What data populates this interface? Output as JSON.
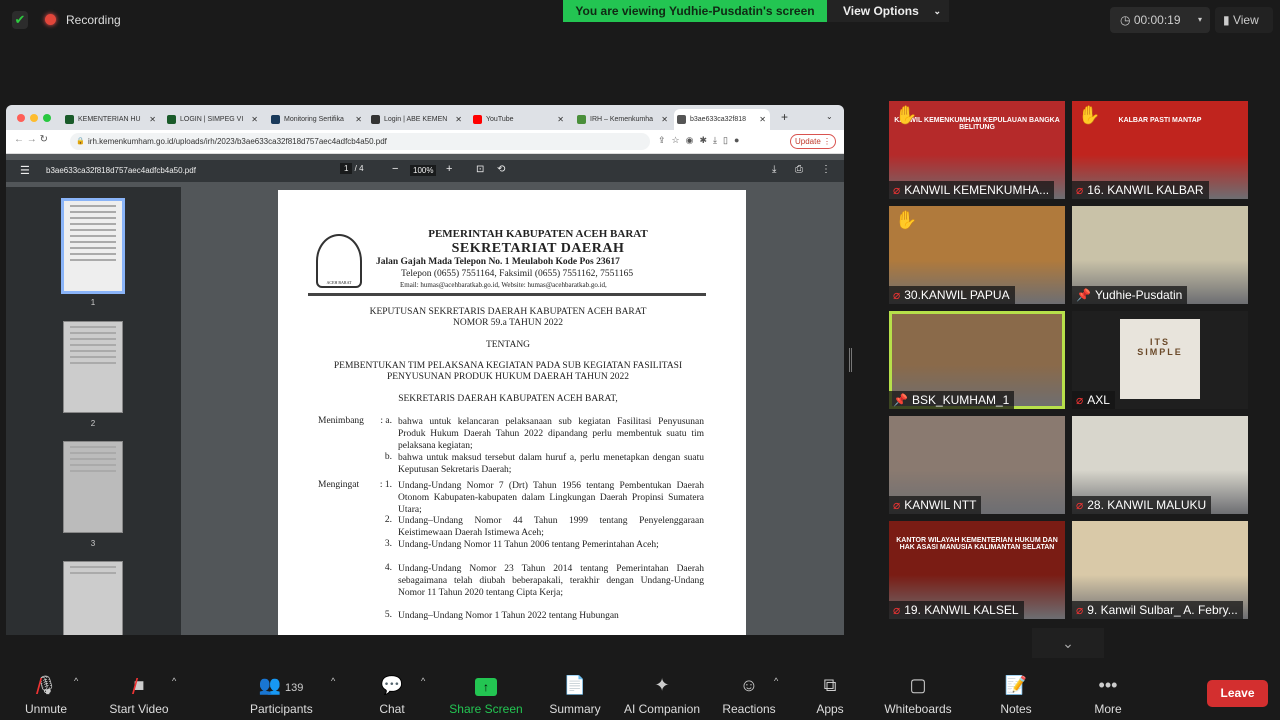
{
  "top": {
    "recording": "Recording",
    "viewing": "You are viewing Yudhie-Pusdatin's screen",
    "view_options": "View Options",
    "timer": "00:00:19",
    "view": "View"
  },
  "browser": {
    "tabs": [
      {
        "label": "KEMENTERIAN HU",
        "color": "#1a5b2a"
      },
      {
        "label": "LOGIN | SIMPEG VI",
        "color": "#1a5b2a"
      },
      {
        "label": "Monitoring Sertifika",
        "color": "#1a3a5b"
      },
      {
        "label": "Login | ABE KEMEN",
        "color": "#333"
      },
      {
        "label": "YouTube",
        "color": "#ff0000"
      },
      {
        "label": "IRH – Kemenkumha",
        "color": "#4a8f3a"
      },
      {
        "label": "b3ae633ca32f818",
        "color": "#555"
      }
    ],
    "url": "irh.kemenkumham.go.id/uploads/irh/2023/b3ae633ca32f818d757aec4adfcb4a50.pdf",
    "update": "Update",
    "pdf": {
      "filename": "b3ae633ca32f818d757aec4adfcb4a50.pdf",
      "page": "1",
      "pages": "4",
      "zoom": "100%",
      "thumbs": [
        "1",
        "2",
        "3"
      ]
    }
  },
  "doc": {
    "h1": "PEMERINTAH KABUPATEN ACEH BARAT",
    "h2": "SEKRETARIAT DAERAH",
    "h3": "Jalan Gajah Mada Telepon No. 1 Meulaboh Kode Pos 23617",
    "h4": "Telepon (0655) 7551164, Faksimil  (0655) 7551162, 7551165",
    "h5": "Email: humas@acehbaratkab.go.id, Website: humas@acehbaratkab.go.id,",
    "logo_text": "ACEH BARAT",
    "t1": "KEPUTUSAN SEKRETARIS DAERAH KABUPATEN ACEH BARAT",
    "t2": "NOMOR  59.a TAHUN 2022",
    "t3": "TENTANG",
    "t4": "PEMBENTUKAN TIM PELAKSANA KEGIATAN PADA SUB KEGIATAN FASILITASI",
    "t5": "PENYUSUNAN PRODUK HUKUM DAERAH TAHUN 2022",
    "t6": "SEKRETARIS DAERAH KABUPATEN ACEH BARAT,",
    "menimbang": "Menimbang",
    "mengingat": "Mengingat",
    "m_a": "bahwa untuk kelancaran pelaksanaan sub kegiatan Fasilitasi Penyusunan Produk Hukum Daerah Tahun 2022 dipandang perlu membentuk suatu tim pelaksana kegiatan;",
    "m_b": "bahwa untuk maksud tersebut dalam huruf a, perlu menetapkan dengan suatu Keputusan Sekretaris Daerah;",
    "g1": "Undang-Undang Nomor 7 (Drt) Tahun 1956 tentang Pembentukan Daerah Otonom Kabupaten-kabupaten dalam Lingkungan Daerah Propinsi Sumatera Utara;",
    "g2": "Undang–Undang Nomor 44 Tahun 1999 tentang Penyelenggaraan Keistimewaan Daerah Istimewa Aceh;",
    "g3": "Undang-Undang Nomor 11 Tahun 2006 tentang Pemerintahan Aceh;",
    "g4": "Undang-Undang Nomor 23 Tahun 2014 tentang Pemerintahan Daerah sebagaimana telah diubah beberapakali, terakhir dengan Undang-Undang Nomor 11 Tahun 2020 tentang Cipta Kerja;",
    "g5": "Undang–Undang Nomor 1 Tahun 2022 tentang Hubungan"
  },
  "tiles": [
    {
      "name": "KANWIL KEMENKUMHA...",
      "banner": "KANWIL KEMENKUMHAM KEPULAUAN BANGKA BELITUNG",
      "bg": "#b52a2a",
      "hand": true,
      "muted": true
    },
    {
      "name": "16. KANWIL KALBAR",
      "banner": "KALBAR PASTI MANTAP",
      "bg": "#c0241e",
      "hand": true,
      "muted": true
    },
    {
      "name": "30.KANWIL PAPUA",
      "banner": "",
      "bg": "#b07a3c",
      "hand": true,
      "muted": true
    },
    {
      "name": "Yudhie-Pusdatin",
      "banner": "",
      "bg": "#c9c2a8",
      "hand": false,
      "muted": false
    },
    {
      "name": "BSK_KUMHAM_1",
      "banner": "",
      "bg": "#8a6a4a",
      "hand": false,
      "muted": false,
      "speaking": true
    },
    {
      "name": "AXL",
      "banner": "ITS SIMPLE",
      "bg": "#1f1f1f",
      "hand": false,
      "muted": true
    },
    {
      "name": "KANWIL NTT",
      "banner": "",
      "bg": "#8a7a70",
      "hand": false,
      "muted": true
    },
    {
      "name": "28. KANWIL MALUKU",
      "banner": "",
      "bg": "#d8d6cc",
      "hand": false,
      "muted": true
    },
    {
      "name": "19. KANWIL KALSEL",
      "banner": "KANTOR WILAYAH KEMENTERIAN HUKUM DAN HAK ASASI MANUSIA KALIMANTAN SELATAN",
      "bg": "#7a1c14",
      "hand": false,
      "muted": true
    },
    {
      "name": "9. Kanwil Sulbar_ A. Febry...",
      "banner": "",
      "bg": "#d9c9a8",
      "hand": false,
      "muted": true
    }
  ],
  "toolbar": {
    "unmute": "Unmute",
    "start_video": "Start Video",
    "participants": "Participants",
    "participant_count": "139",
    "chat": "Chat",
    "share": "Share Screen",
    "summary": "Summary",
    "ai": "AI Companion",
    "reactions": "Reactions",
    "apps": "Apps",
    "whiteboards": "Whiteboards",
    "notes": "Notes",
    "more": "More",
    "leave": "Leave",
    "share_color": "#23c552",
    "leave_color": "#d32f2f"
  }
}
